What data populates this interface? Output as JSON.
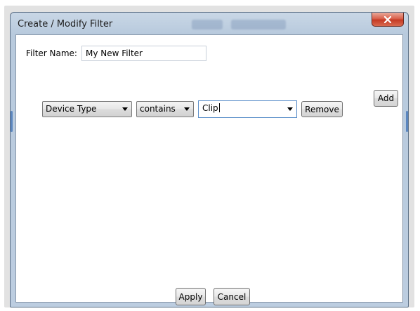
{
  "window": {
    "title": "Create / Modify Filter",
    "close_label": "x"
  },
  "form": {
    "filter_name_label": "Filter Name:",
    "filter_name_value": "My New Filter",
    "add_label": "Add"
  },
  "criteria": [
    {
      "field": "Device Type",
      "operator": "contains",
      "value": "Clip",
      "remove_label": "Remove"
    }
  ],
  "footer": {
    "apply_label": "Apply",
    "cancel_label": "Cancel"
  },
  "icons": {
    "close": "close-icon",
    "dropdown": "chevron-down-icon"
  },
  "colors": {
    "frame": "#bccde0",
    "close_button": "#c53a24",
    "focus_border": "#5a8ec9"
  }
}
